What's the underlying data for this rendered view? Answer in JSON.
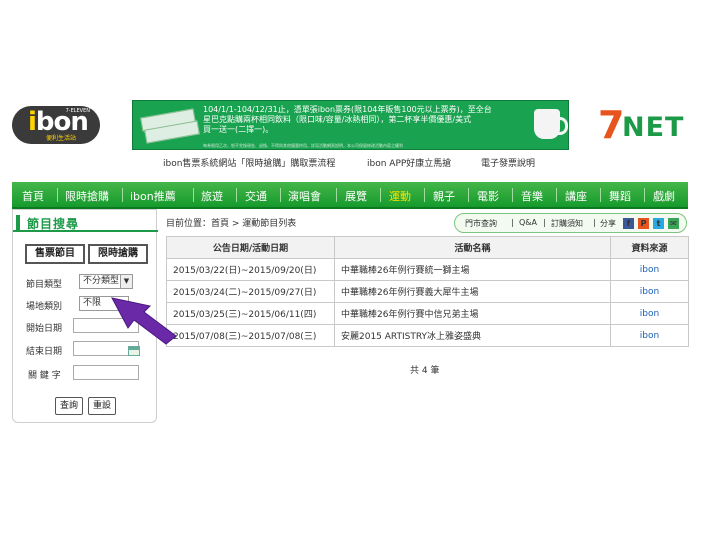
{
  "header": {
    "ibon_logo": {
      "brand_i": "i",
      "brand_rest": "bon",
      "small": "7-ELEVEN",
      "sub": "便利生活站"
    },
    "banner": {
      "line1": "104/1/1-104/12/31止，憑單張ibon票券(限104年販售100元以上票券)，至全台",
      "line2": "星巴克點購兩杯相同飲料（限口味/容量/冰熱相同），第二杯享半價優惠/美式",
      "line3": "買一送一(二擇一)。",
      "fine": "每券限用乙次，恕不兌換現金、退換、不得與其他優惠併用，詳見活動網頁說明，本公司保留修改活動內容之權利"
    },
    "net_logo": {
      "seven": "7",
      "net": "NET"
    },
    "links": [
      "ibon售票系統網站「限時搶購」購取票流程",
      "ibon APP好康立馬搶",
      "電子發票說明"
    ]
  },
  "nav": {
    "items": [
      "首頁",
      "限時搶購",
      "ibon推薦",
      "旅遊",
      "交通",
      "演唱會",
      "展覽",
      "運動",
      "親子",
      "電影",
      "音樂",
      "講座",
      "舞蹈",
      "戲劇"
    ],
    "active": "運動"
  },
  "sidebar": {
    "title": "節目搜尋",
    "tabs": [
      "售票節目",
      "限時搶購"
    ],
    "fields": {
      "type_label": "節目類型",
      "type_value": "不分類型",
      "venue_label": "場地類別",
      "venue_value": "不限",
      "start_label": "開始日期",
      "end_label": "結束日期",
      "keyword_label": "關 鍵 字"
    },
    "buttons": {
      "search": "查詢",
      "reset": "重設"
    }
  },
  "main": {
    "breadcrumb": "目前位置：首頁 > 運動節目列表",
    "util": {
      "store": "門市查詢",
      "qa": "Q&A",
      "notice": "訂購須知",
      "share": "分享",
      "sep": "|"
    },
    "table": {
      "headers": [
        "公告日期/活動日期",
        "活動名稱",
        "資料來源"
      ],
      "rows": [
        [
          "2015/03/22(日)~2015/09/20(日)",
          "中華職棒26年例行賽統一獅主場",
          "ibon"
        ],
        [
          "2015/03/24(二)~2015/09/27(日)",
          "中華職棒26年例行賽義大犀牛主場",
          "ibon"
        ],
        [
          "2015/03/25(三)~2015/06/11(四)",
          "中華職棒26年例行賽中信兄弟主場",
          "ibon"
        ],
        [
          "2015/07/08(三)~2015/07/08(三)",
          "安麗2015 ARTISTRY冰上雅姿盛典",
          "ibon"
        ]
      ]
    },
    "total": "共 4 筆"
  },
  "colors": {
    "green": "#1c9a48",
    "nav_active": "#ffe400",
    "arrow": "#6a2aa8",
    "link": "#1a5fb4"
  }
}
